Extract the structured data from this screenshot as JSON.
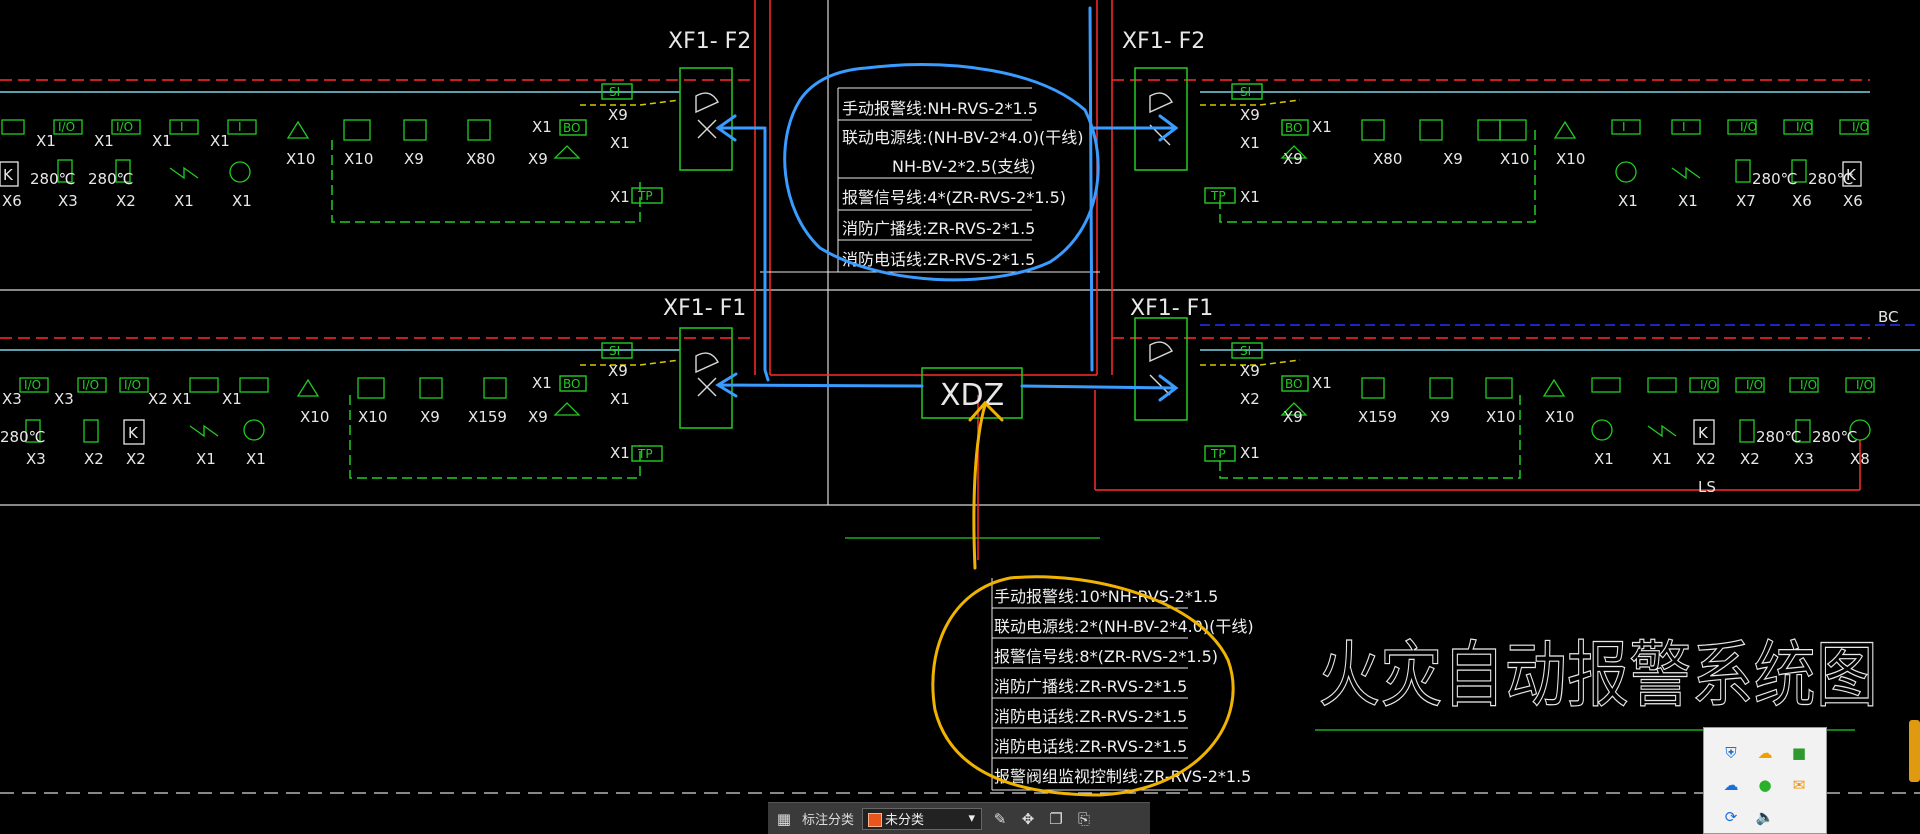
{
  "diagram": {
    "title": "火灾自动报警系统图",
    "center_panel": "XDZ",
    "sections": [
      {
        "id": "F2-left",
        "label": "XF1- F2"
      },
      {
        "id": "F2-right",
        "label": "XF1- F2"
      },
      {
        "id": "F1-left",
        "label": "XF1- F1"
      },
      {
        "id": "F1-right",
        "label": "XF1- F1"
      }
    ],
    "module_labels": {
      "si": "SI",
      "tp": "TP",
      "bo": "BO",
      "io": "I/O",
      "i": "I"
    },
    "temp_label": "280℃",
    "row_f2_left": [
      "X6",
      "X3",
      "X2",
      "X1",
      "X1",
      "X10",
      "X10",
      "X9",
      "X80",
      "X9"
    ],
    "row_f2_left_top": [
      "X1",
      "X1",
      "X1",
      "X1"
    ],
    "row_f2_right": [
      "X9",
      "X80",
      "X9",
      "X10",
      "X10",
      "X1",
      "X1",
      "X7",
      "X6",
      "X6"
    ],
    "row_f1_left": [
      "X3",
      "X2",
      "X2",
      "X1",
      "X1",
      "X10",
      "X10",
      "X9",
      "X159",
      "X9"
    ],
    "row_f1_left_top": [
      "X3",
      "X3",
      "X2",
      "X1",
      "X1"
    ],
    "row_f1_right": [
      "X9",
      "X159",
      "X9",
      "X10",
      "X10",
      "X1",
      "X1",
      "X2",
      "X2",
      "X3",
      "X8"
    ],
    "side_labels": {
      "x9": "X9",
      "x1": "X1",
      "x2": "X2",
      "ls": "LS",
      "bc": "BC",
      "k": "K",
      "l": "L"
    },
    "upper_note": [
      "手动报警线:NH-RVS-2*1.5",
      "联动电源线:(NH-BV-2*4.0)(干线)",
      "NH-BV-2*2.5(支线)",
      "报警信号线:4*(ZR-RVS-2*1.5)",
      "消防广播线:ZR-RVS-2*1.5",
      "消防电话线:ZR-RVS-2*1.5"
    ],
    "lower_note": [
      "手动报警线:10*NH-RVS-2*1.5",
      "联动电源线:2*(NH-BV-2*4.0)(干线)",
      "报警信号线:8*(ZR-RVS-2*1.5)",
      "消防广播线:ZR-RVS-2*1.5",
      "消防电话线:ZR-RVS-2*1.5",
      "消防电话线:ZR-RVS-2*1.5",
      "报警阀组监视控制线:ZR-RVS-2*1.5"
    ],
    "colors": {
      "background": "#000000",
      "green": "#22cc22",
      "cyan": "#7ad4e6",
      "red": "#ff2a2a",
      "blue_annotation": "#3a9cff",
      "yellow_annotation": "#f0b400",
      "white": "#e8e8e8",
      "yellow_dashed": "#d8c800"
    }
  },
  "toolbar": {
    "label": "标注分类",
    "selected": "未分类",
    "icons": [
      "grid-icon",
      "edit-icon",
      "move-icon",
      "copy-icon",
      "paste-icon"
    ]
  },
  "tray": {
    "icons": [
      "shield-icon",
      "weather-icon",
      "nvidia-icon",
      "cloud-icon",
      "wechat-icon",
      "mail-icon",
      "sync-icon",
      "volume-icon"
    ]
  }
}
